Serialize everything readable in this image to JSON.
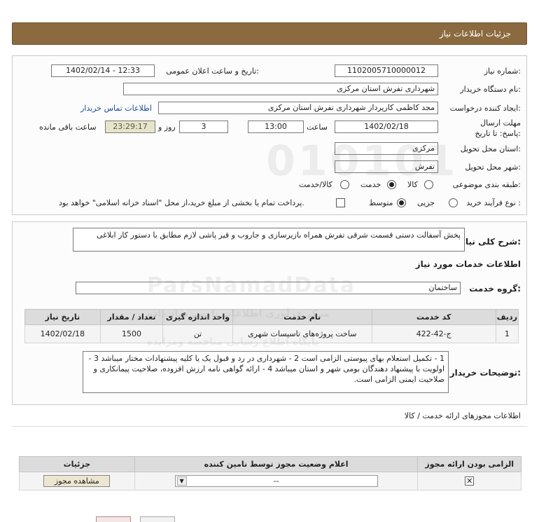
{
  "header": {
    "title": "جزئیات اطلاعات نیاز"
  },
  "form": {
    "need_number_label": "شماره نیاز:",
    "need_number": "1102005710000012",
    "announce_label": "تاریخ و ساعت اعلان عمومی:",
    "announce_value": "1402/02/14 - 12:33",
    "buyer_org_label": "نام دستگاه خریدار:",
    "buyer_org": "شهرداری تفرش استان مرکزی",
    "creator_label": "ایجاد کننده درخواست:",
    "creator": "مجد کاظمی کارپرداز شهرداری تفرش استان مرکزی",
    "contact_link": "اطلاعات تماس خریدار",
    "deadline_label": "مهلت ارسال پاسخ: تا تاریخ:",
    "deadline_date": "1402/02/18",
    "time_label": "ساعت",
    "deadline_time": "13:00",
    "days_value": "3",
    "days_label": "روز و",
    "remaining_time": "23:29:17",
    "remaining_label": "ساعت باقی مانده",
    "province_label": "استان محل تحویل:",
    "province": "مرکزی",
    "city_label": "شهر محل تحویل:",
    "city": "تفرش",
    "category_label": "طبقه بندی موضوعی:",
    "category_options": [
      "کالا",
      "خدمت",
      "کالا/خدمت"
    ],
    "process_label": "نوع فرآیند خرید :",
    "process_options": [
      "جزیی",
      "متوسط"
    ],
    "payment_note": "پرداخت تمام یا بخشی از مبلغ خرید،از محل \"اسناد خزانه اسلامی\" خواهد بود."
  },
  "summary": {
    "label": "شرح کلی نیاز:",
    "text": "پخش آسفالت دستی قسمت شرقی تفرش همراه بازیرسازی و جاروب و قیر پاشی لازم مطابق با دستور کار ابلاغی"
  },
  "services": {
    "section_title": "اطلاعات خدمات مورد نیاز",
    "group_label": "گروه خدمت:",
    "group_value": "ساختمان",
    "columns": [
      "ردیف",
      "کد خدمت",
      "نام خدمت",
      "واحد اندازه گیری",
      "تعداد / مقدار",
      "تاریخ نیاز"
    ],
    "rows": [
      [
        "1",
        "ج-42-422",
        "ساخت پروژه‌های تاسیسات شهری",
        "تن",
        "1500",
        "1402/02/18"
      ]
    ]
  },
  "buyer_notes": {
    "label": "توضیحات خریدار:",
    "text": "1 - تکمیل استعلام بهای پیوستی الزامی است 2 - شهرداری در رد و قبول یک یا کلیه پیشنهادات مختار میباشد 3 - اولویت با پیشنهاد دهندگان بومی شهر و استان میباشد 4 - ارائه گواهی نامه ارزش افزوده، صلاحیت پیمانکاری و صلاحیت ایمنی الزامی است."
  },
  "permits": {
    "title": "اطلاعات مجوزهای ارائه خدمت / کالا",
    "columns": [
      "الزامی بودن ارائه مجوز",
      "اعلام وضعیت مجوز توسط نامین کننده",
      "جزئیات"
    ],
    "status_value": "--",
    "view_button": "مشاهده مجوز"
  },
  "watermark": {
    "line1": "ParsNamadData",
    "line2": "مرکز فرآوری اطلاعات پارس نماد داده",
    "line3": "پایگاه اطلاع رسانی مناقصه ومزایده"
  }
}
